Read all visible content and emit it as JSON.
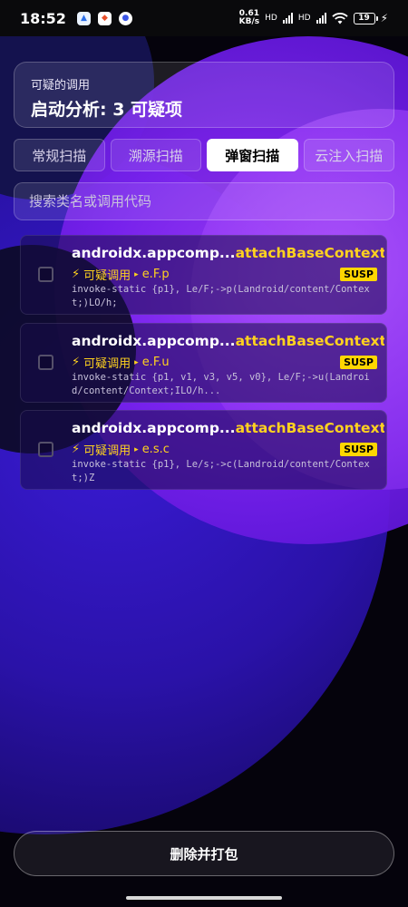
{
  "status_bar": {
    "time": "18:52",
    "net_speed_value": "0.61",
    "net_speed_unit": "KB/s",
    "signal_label_1": "HD",
    "signal_label_2": "HD",
    "battery": "19"
  },
  "header": {
    "subtitle": "可疑的调用",
    "title": "启动分析: 3 可疑项"
  },
  "tabs": [
    {
      "label": "常规扫描",
      "active": false
    },
    {
      "label": "溯源扫描",
      "active": false
    },
    {
      "label": "弹窗扫描",
      "active": true
    },
    {
      "label": "云注入扫描",
      "active": false
    }
  ],
  "search": {
    "placeholder": "搜索类名或调用代码"
  },
  "results": [
    {
      "class_name": "androidx.appcomp...",
      "method": "attachBaseContext",
      "tag_icon": "⚡",
      "tag": "可疑调用",
      "arrow": "▸",
      "ref": "e.F.p",
      "badge": "SUSP",
      "code": "invoke-static {p1}, Le/F;->p(Landroid/content/Context;)LO/h;"
    },
    {
      "class_name": "androidx.appcomp...",
      "method": "attachBaseContext",
      "tag_icon": "⚡",
      "tag": "可疑调用",
      "arrow": "▸",
      "ref": "e.F.u",
      "badge": "SUSP",
      "code": "invoke-static {p1, v1, v3, v5, v0}, Le/F;->u(Landroid/content/Context;ILO/h..."
    },
    {
      "class_name": "androidx.appcomp...",
      "method": "attachBaseContext",
      "tag_icon": "⚡",
      "tag": "可疑调用",
      "arrow": "▸",
      "ref": "e.s.c",
      "badge": "SUSP",
      "code": "invoke-static {p1}, Le/s;->c(Landroid/content/Context;)Z"
    }
  ],
  "action_button": "删除并打包",
  "colors": {
    "accent_yellow": "#ffd21f",
    "badge_bg": "#ffd600",
    "active_tab_bg": "#ffffff"
  }
}
